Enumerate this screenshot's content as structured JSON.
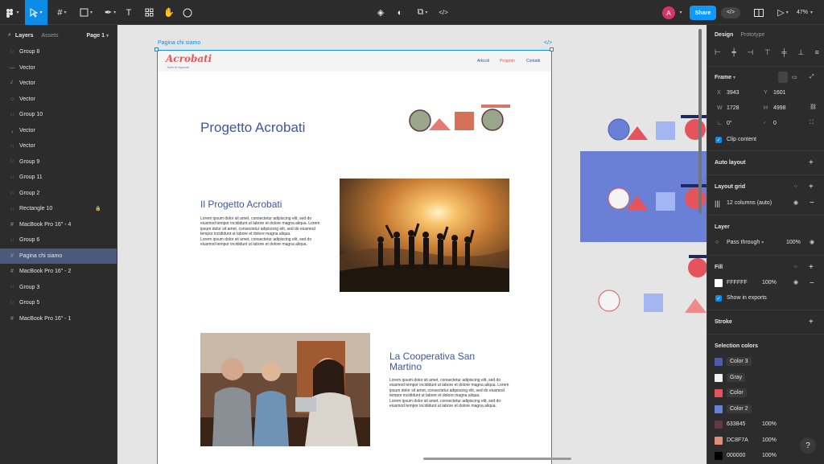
{
  "toolbar": {
    "share_label": "Share",
    "avatar_initial": "A",
    "zoom": "47%"
  },
  "left_panel": {
    "tabs": [
      "Layers",
      "Assets"
    ],
    "page": "Page 1",
    "layers": [
      {
        "name": "Group 8",
        "icon": "frame-dotted"
      },
      {
        "name": "Vector",
        "icon": "line"
      },
      {
        "name": "Vector",
        "icon": "curve"
      },
      {
        "name": "Vector",
        "icon": "circle"
      },
      {
        "name": "Group 10",
        "icon": "frame-dotted"
      },
      {
        "name": "Vector",
        "icon": "corner"
      },
      {
        "name": "Vector",
        "icon": "frame-dotted"
      },
      {
        "name": "Group 9",
        "icon": "frame-dotted"
      },
      {
        "name": "Group 11",
        "icon": "frame-dotted"
      },
      {
        "name": "Group 2",
        "icon": "frame-dotted"
      },
      {
        "name": "Rectangle 10",
        "icon": "frame-dotted",
        "locked": true
      },
      {
        "name": "MacBook Pro 16\" - 4",
        "icon": "hash"
      },
      {
        "name": "Group 6",
        "icon": "frame-dotted"
      },
      {
        "name": "Pagina chi siamo",
        "icon": "hash",
        "selected": true
      },
      {
        "name": "MacBook Pro 16\" - 2",
        "icon": "hash"
      },
      {
        "name": "Group 3",
        "icon": "frame-dotted"
      },
      {
        "name": "Group 5",
        "icon": "frame-dotted"
      },
      {
        "name": "MacBook Pro 16\" - 1",
        "icon": "hash"
      }
    ]
  },
  "canvas": {
    "frame_label": "Pagina chi siamo",
    "code_label": "</>",
    "site": {
      "logo": "Acrobati",
      "logo_sub": "Tutte le risposte",
      "nav": [
        "Articoli",
        "Progetto",
        "Contatti"
      ],
      "nav_active": "Progetto",
      "hero_title": "Progetto Acrobati",
      "section1_title": "Il Progetto Acrobati",
      "section1_text": "Lorem ipsum dolor sit amet, consectetur adipiscing elit, sed do eiusmod tempor incididunt ut labore et dolore magna aliqua. Lorem ipsum dolor sit amet, consectetur adipiscing elit, sed do eiusmod tempor incididunt ut labore et dolore magna aliqua.\nLorem ipsum dolor sit amet, consectetur adipiscing elit, sed do eiusmod tempor incididunt ut labore et dolore magna aliqua.",
      "section2_title": "La Cooperativa San Martino",
      "section2_text": "Lorem ipsum dolor sit amet, consectetur adipiscing elit, sed do eiusmod tempor incididunt ut labore et dolore magna aliqua. Lorem ipsum dolor sit amet, consectetur adipiscing elit, sed do eiusmod tempor incididunt ut labore et dolore magna aliqua.\nLorem ipsum dolor sit amet, consectetur adipiscing elit, sed do eiusmod tempor incididunt ut labore et dolore magna aliqua."
    }
  },
  "right_panel": {
    "tabs": [
      "Design",
      "Prototype"
    ],
    "frame_label": "Frame",
    "x_label": "X",
    "x": "3943",
    "y_label": "Y",
    "y": "1601",
    "w_label": "W",
    "w": "1728",
    "h_label": "H",
    "h": "4998",
    "rotation": "0°",
    "radius": "0",
    "clip_content": "Clip content",
    "auto_layout": "Auto layout",
    "layout_grid": "Layout grid",
    "grid_value": "12 columns (auto)",
    "layer": "Layer",
    "blend": "Pass through",
    "layer_opacity": "100%",
    "fill": "Fill",
    "fill_hex": "FFFFFF",
    "fill_opacity": "100%",
    "show_in_exports": "Show in exports",
    "stroke": "Stroke",
    "selection_colors": "Selection colors",
    "colors": [
      {
        "label": "Color 3",
        "hex": "#4a5bb0",
        "chip": true
      },
      {
        "label": "Gray",
        "hex": "#f2f2f2",
        "chip": true
      },
      {
        "label": "Color",
        "hex": "#e5535b",
        "chip": true
      },
      {
        "label": "Color 2",
        "hex": "#6a7fd6",
        "chip": true
      },
      {
        "label": "633845",
        "hex": "#633845",
        "opacity": "100%"
      },
      {
        "label": "DC8F7A",
        "hex": "#dc8f7a",
        "opacity": "100%"
      },
      {
        "label": "000000",
        "hex": "#000000",
        "opacity": "100%"
      }
    ],
    "help": "?"
  }
}
